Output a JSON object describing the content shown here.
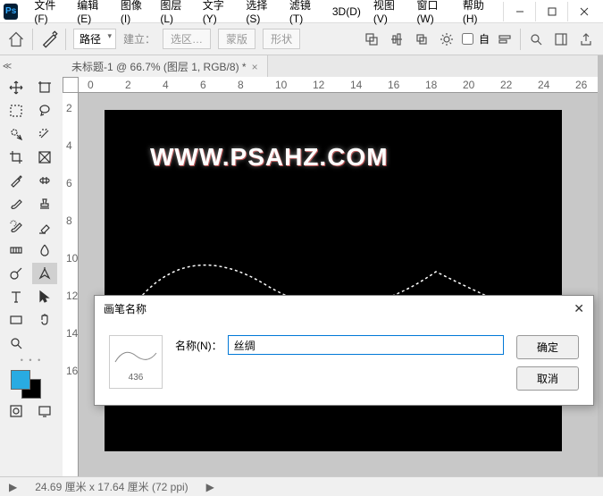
{
  "menu": [
    "文件(F)",
    "编辑(E)",
    "图像(I)",
    "图层(L)",
    "文字(Y)",
    "选择(S)",
    "滤镜(T)",
    "3D(D)",
    "视图(V)",
    "窗口(W)",
    "帮助(H)"
  ],
  "toolbar": {
    "path_mode": "路径",
    "build_label": "建立：",
    "btn_selection": "选区…",
    "btn_mask": "蒙版",
    "btn_shape": "形状",
    "auto_label": "自"
  },
  "doc_tab": "未标题-1 @ 66.7% (图层 1, RGB/8) *",
  "watermark": "WWW.PSAHZ.COM",
  "ruler_h": [
    "0",
    "2",
    "4",
    "6",
    "8",
    "10",
    "12",
    "14",
    "16",
    "18",
    "20",
    "22",
    "24",
    "26"
  ],
  "ruler_v": [
    "2",
    "4",
    "6",
    "8",
    "10",
    "12",
    "14",
    "16"
  ],
  "dialog": {
    "title": "画笔名称",
    "name_label": "名称(N)：",
    "name_value": "丝绸",
    "brush_size": "436",
    "ok": "确定",
    "cancel": "取消"
  },
  "status": {
    "arrow": "▶",
    "dims": "24.69 厘米 x 17.64 厘米 (72 ppi)",
    "arrow2": "▶"
  }
}
